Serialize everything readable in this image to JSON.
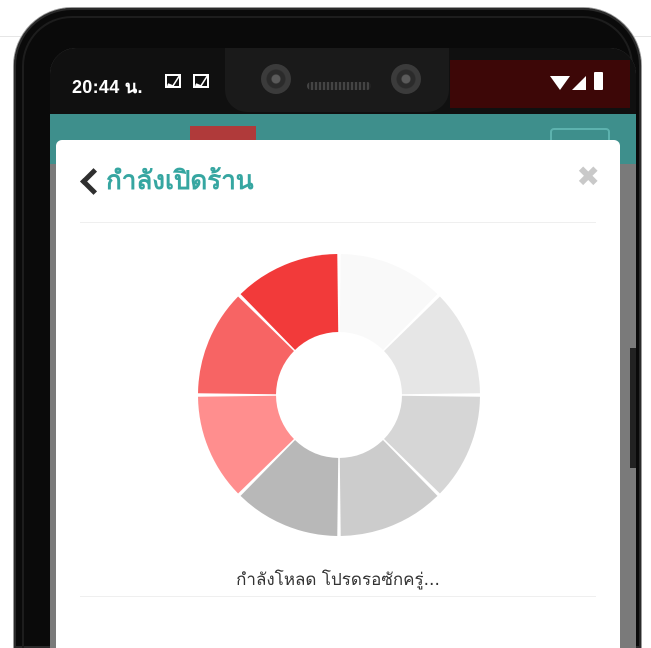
{
  "status_bar": {
    "time": "20:44 น."
  },
  "modal": {
    "title": "กำลังเปิดร้าน",
    "close_symbol": "✖",
    "loading_text": "กำลังโหลด โปรดรอซักครู่..."
  },
  "spinner": {
    "segments": [
      {
        "color": "#f9f9f9"
      },
      {
        "color": "#e6e6e6"
      },
      {
        "color": "#d6d6d6"
      },
      {
        "color": "#cccccc"
      },
      {
        "color": "#b8b8b8"
      },
      {
        "color": "#ff8e8e"
      },
      {
        "color": "#f76464"
      },
      {
        "color": "#f23a3a"
      }
    ]
  },
  "colors": {
    "accent": "#36a6a1",
    "header_teal": "#3e8f8c",
    "brand_red": "#c42b2b"
  },
  "icons": [
    "mail-icon",
    "wifi-icon",
    "signal-icon",
    "battery-icon",
    "back-icon",
    "close-icon"
  ]
}
